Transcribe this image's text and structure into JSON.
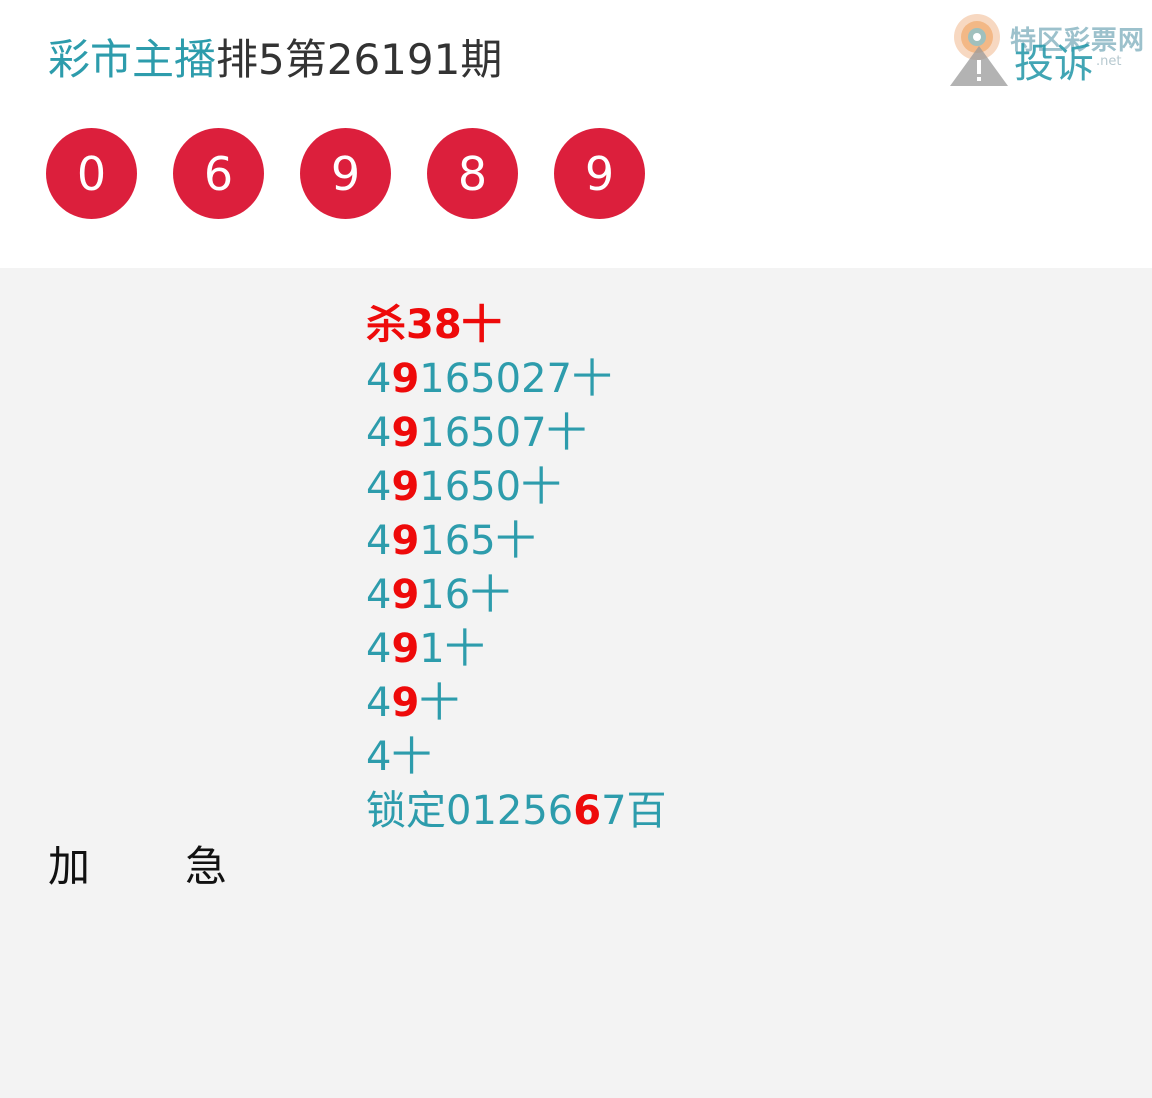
{
  "header": {
    "brand": "彩市主播",
    "title_rest": "排5第26191期",
    "balls": [
      "0",
      "6",
      "9",
      "8",
      "9"
    ]
  },
  "watermark": {
    "site_name": "特区彩票网",
    "site_domain": ".net",
    "report_label": "投诉",
    "icon": "warning-icon"
  },
  "colors": {
    "brand_teal": "#2d9cac",
    "ball_red": "#dc1f3c",
    "highlight_red": "#ee0a0a",
    "content_bg": "#f3f3f3"
  },
  "kill_line": "杀38十",
  "lines": [
    {
      "pre": "4",
      "hl": "9",
      "post": "165027十"
    },
    {
      "pre": "4",
      "hl": "9",
      "post": "16507十"
    },
    {
      "pre": "4",
      "hl": "9",
      "post": "1650十"
    },
    {
      "pre": "4",
      "hl": "9",
      "post": "165十"
    },
    {
      "pre": "4",
      "hl": "9",
      "post": "16十"
    },
    {
      "pre": "4",
      "hl": "9",
      "post": "1十"
    },
    {
      "pre": "4",
      "hl": "9",
      "post": "十"
    },
    {
      "pre": "4十",
      "hl": "",
      "post": ""
    },
    {
      "pre": "锁定01256",
      "hl": "6",
      "post": "7百"
    }
  ],
  "footer": {
    "char1": "加",
    "char2": "急"
  }
}
